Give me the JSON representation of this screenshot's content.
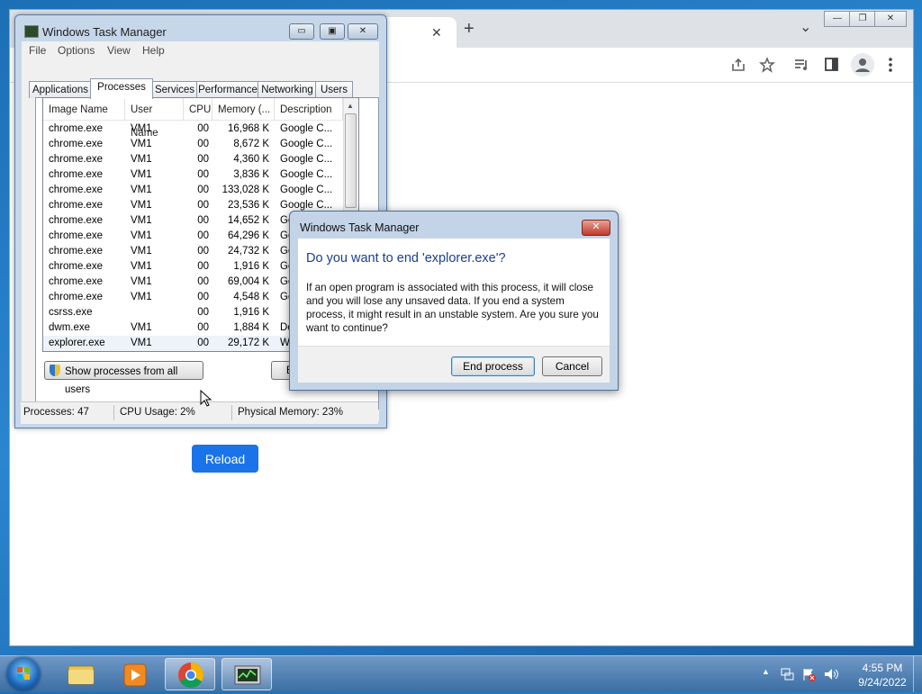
{
  "browser": {
    "tab_close": "✕",
    "new_tab": "+",
    "tabs_dropdown": "⌄",
    "reload_label": "Reload",
    "window_controls": [
      "—",
      "❐",
      "✕"
    ]
  },
  "taskmgr": {
    "title": "Windows Task Manager",
    "menu": [
      "File",
      "Options",
      "View",
      "Help"
    ],
    "tabs": [
      "Applications",
      "Processes",
      "Services",
      "Performance",
      "Networking",
      "Users"
    ],
    "active_tab": "Processes",
    "columns": [
      "Image Name",
      "User Name",
      "CPU",
      "Memory (...",
      "Description"
    ],
    "rows": [
      {
        "image": "chrome.exe",
        "user": "VM1",
        "cpu": "00",
        "mem": "16,968 K",
        "desc": "Google C..."
      },
      {
        "image": "chrome.exe",
        "user": "VM1",
        "cpu": "00",
        "mem": "8,672 K",
        "desc": "Google C..."
      },
      {
        "image": "chrome.exe",
        "user": "VM1",
        "cpu": "00",
        "mem": "4,360 K",
        "desc": "Google C..."
      },
      {
        "image": "chrome.exe",
        "user": "VM1",
        "cpu": "00",
        "mem": "3,836 K",
        "desc": "Google C..."
      },
      {
        "image": "chrome.exe",
        "user": "VM1",
        "cpu": "00",
        "mem": "133,028 K",
        "desc": "Google C..."
      },
      {
        "image": "chrome.exe",
        "user": "VM1",
        "cpu": "00",
        "mem": "23,536 K",
        "desc": "Google C..."
      },
      {
        "image": "chrome.exe",
        "user": "VM1",
        "cpu": "00",
        "mem": "14,652 K",
        "desc": "Go"
      },
      {
        "image": "chrome.exe",
        "user": "VM1",
        "cpu": "00",
        "mem": "64,296 K",
        "desc": "Go"
      },
      {
        "image": "chrome.exe",
        "user": "VM1",
        "cpu": "00",
        "mem": "24,732 K",
        "desc": "Go"
      },
      {
        "image": "chrome.exe",
        "user": "VM1",
        "cpu": "00",
        "mem": "1,916 K",
        "desc": "Go"
      },
      {
        "image": "chrome.exe",
        "user": "VM1",
        "cpu": "00",
        "mem": "69,004 K",
        "desc": "Go"
      },
      {
        "image": "chrome.exe",
        "user": "VM1",
        "cpu": "00",
        "mem": "4,548 K",
        "desc": "Go"
      },
      {
        "image": "csrss.exe",
        "user": "",
        "cpu": "00",
        "mem": "1,916 K",
        "desc": ""
      },
      {
        "image": "dwm.exe",
        "user": "VM1",
        "cpu": "00",
        "mem": "1,884 K",
        "desc": "De"
      },
      {
        "image": "explorer.exe",
        "user": "VM1",
        "cpu": "00",
        "mem": "29,172 K",
        "desc": "W"
      }
    ],
    "selected_row": 14,
    "show_all_label": "Show processes from all users",
    "end_process_partial": "E",
    "status": {
      "processes": "Processes: 47",
      "cpu": "CPU Usage: 2%",
      "memory": "Physical Memory: 23%"
    }
  },
  "dialog": {
    "title": "Windows Task Manager",
    "heading": "Do you want to end 'explorer.exe'?",
    "body": "If an open program is associated with this process, it will close and you will lose any unsaved data. If you end a system process, it might result in an unstable system. Are you sure you want to continue?",
    "confirm_label": "End process",
    "cancel_label": "Cancel",
    "close_glyph": "✕"
  },
  "taskbar": {
    "time": "4:55 PM",
    "date": "9/24/2022",
    "pinned": [
      "explorer-folder-icon",
      "media-player-icon",
      "chrome-icon",
      "task-manager-icon"
    ]
  }
}
